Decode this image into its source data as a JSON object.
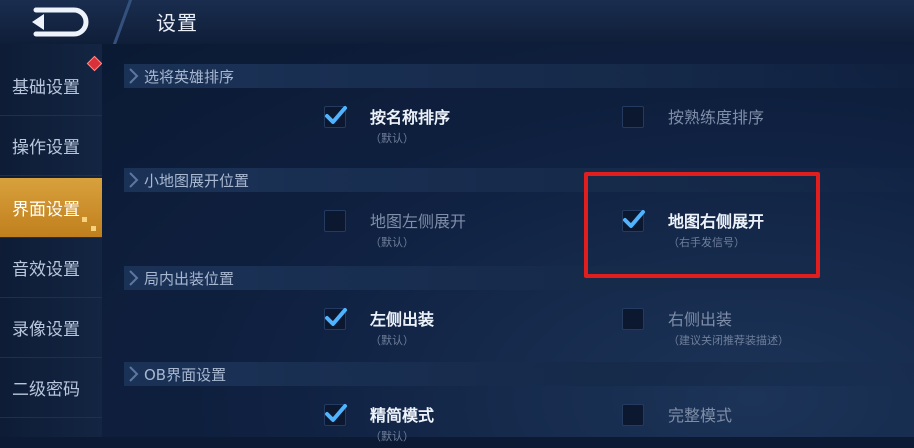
{
  "header": {
    "title": "设置"
  },
  "sidebar": {
    "items": [
      {
        "label": "基础设置",
        "active": false,
        "badge": true
      },
      {
        "label": "操作设置",
        "active": false
      },
      {
        "label": "界面设置",
        "active": true
      },
      {
        "label": "音效设置",
        "active": false
      },
      {
        "label": "录像设置",
        "active": false
      },
      {
        "label": "二级密码",
        "active": false
      }
    ]
  },
  "sections": [
    {
      "title": "选将英雄排序",
      "options": [
        {
          "label": "按名称排序",
          "sub": "（默认）",
          "checked": true
        },
        {
          "label": "按熟练度排序",
          "sub": "",
          "checked": false
        }
      ]
    },
    {
      "title": "小地图展开位置",
      "options": [
        {
          "label": "地图左侧展开",
          "sub": "（默认）",
          "checked": false
        },
        {
          "label": "地图右侧展开",
          "sub": "（右手发信号）",
          "checked": true
        }
      ]
    },
    {
      "title": "局内出装位置",
      "options": [
        {
          "label": "左侧出装",
          "sub": "（默认）",
          "checked": true
        },
        {
          "label": "右侧出装",
          "sub": "（建议关闭推荐装描述）",
          "checked": false
        }
      ]
    },
    {
      "title": "OB界面设置",
      "options": [
        {
          "label": "精简模式",
          "sub": "（默认）",
          "checked": true
        },
        {
          "label": "完整模式",
          "sub": "",
          "checked": false
        }
      ]
    }
  ],
  "colors": {
    "accent_gold": "#d8a13c",
    "check_blue": "#4fb3ff",
    "highlight_red": "#e01e1e",
    "badge_red": "#d9303a"
  }
}
